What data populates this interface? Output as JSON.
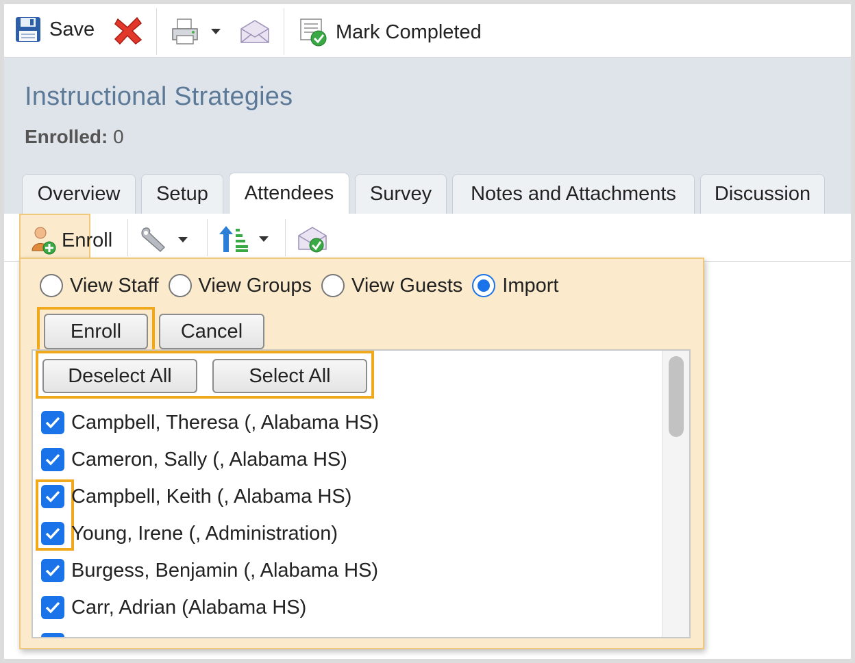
{
  "toolbar": {
    "save_label": "Save",
    "mark_completed_label": "Mark Completed",
    "icons": {
      "save": "floppy-disk-icon",
      "delete": "red-x-icon",
      "print": "printer-icon",
      "dropdown": "caret-down-icon",
      "email": "envelope-icon",
      "mark_completed": "checklist-icon"
    }
  },
  "header": {
    "title": "Instructional Strategies",
    "enrolled_label": "Enrolled:",
    "enrolled_count": "0"
  },
  "tabs": [
    {
      "label": "Overview"
    },
    {
      "label": "Setup"
    },
    {
      "label": "Attendees",
      "active": true
    },
    {
      "label": "Survey"
    },
    {
      "label": "Notes and Attachments"
    },
    {
      "label": "Discussion"
    }
  ],
  "content_toolbar": {
    "enroll_label": "Enroll"
  },
  "enroll_popup": {
    "view_options": [
      {
        "label": "View Staff",
        "selected": false
      },
      {
        "label": "View Groups",
        "selected": false
      },
      {
        "label": "View Guests",
        "selected": false
      },
      {
        "label": "Import",
        "selected": true
      }
    ],
    "enroll_button": "Enroll",
    "cancel_button": "Cancel",
    "deselect_all_button": "Deselect All",
    "select_all_button": "Select All",
    "people": [
      {
        "name": "Campbell, Theresa (, Alabama HS)",
        "checked": true
      },
      {
        "name": "Cameron, Sally (, Alabama HS)",
        "checked": true
      },
      {
        "name": "Campbell, Keith (, Alabama HS)",
        "checked": true
      },
      {
        "name": "Young, Irene (, Administration)",
        "checked": true
      },
      {
        "name": "Burgess, Benjamin (, Alabama HS)",
        "checked": true
      },
      {
        "name": "Carr, Adrian (Alabama HS)",
        "checked": true
      }
    ]
  },
  "colors": {
    "title": "#5c7a98",
    "header_bg": "#dfe4ea",
    "popup_bg": "#fbeacb",
    "highlight": "#f0a81c",
    "checkbox": "#1a73e8"
  }
}
